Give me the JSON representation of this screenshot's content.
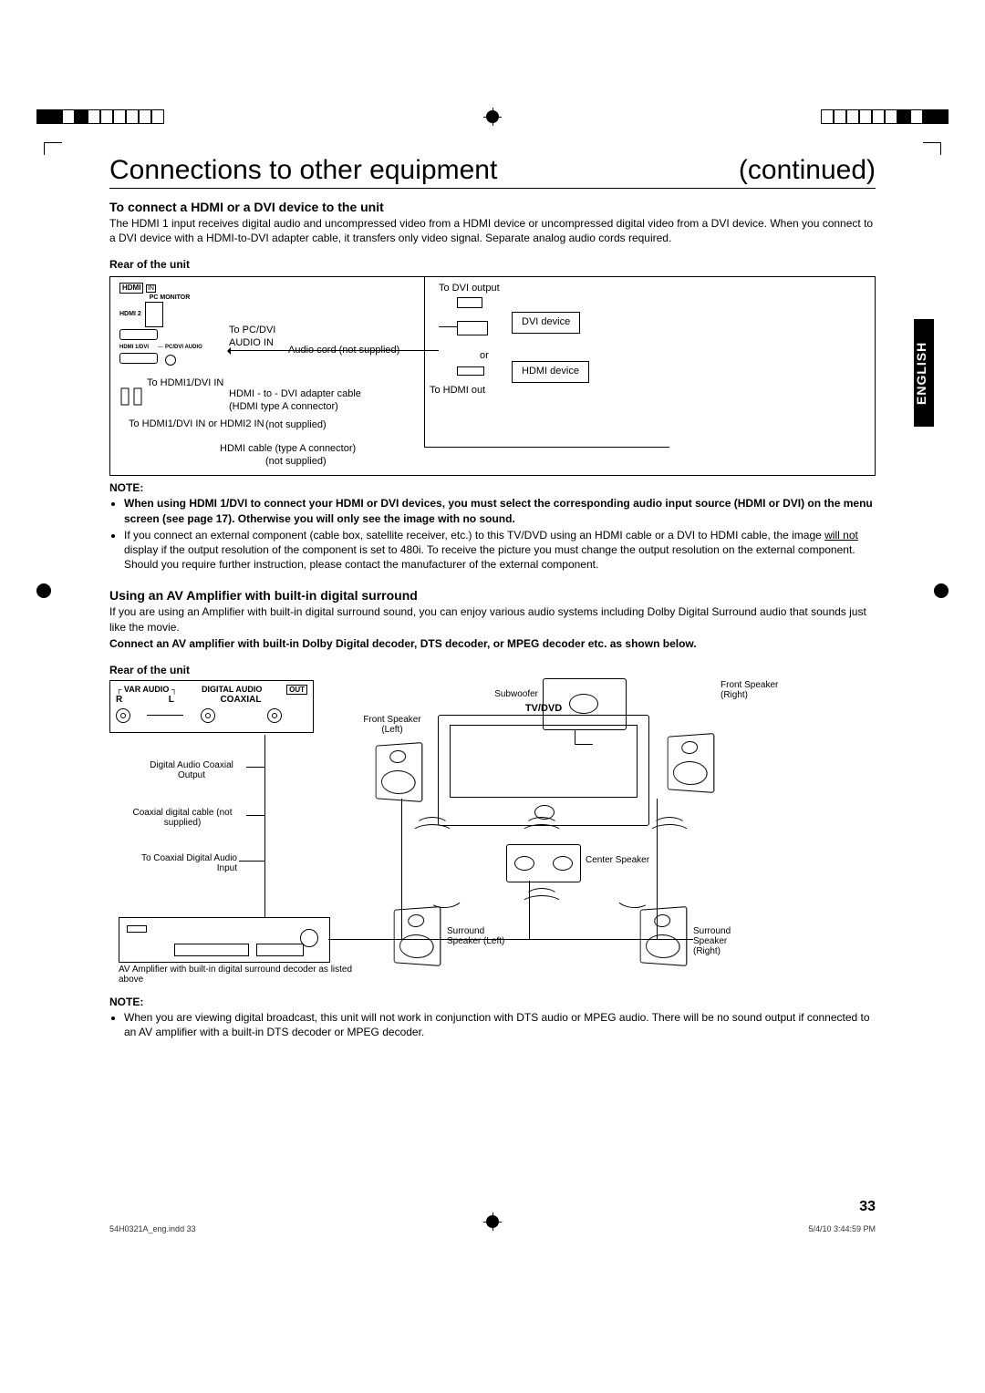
{
  "header": {
    "title": "Connections to other equipment",
    "continued": "(continued)"
  },
  "lang_tab": "ENGLISH",
  "section1": {
    "heading": "To connect a HDMI or a DVI device to the unit",
    "intro": "The HDMI 1 input receives digital audio and uncompressed video from a HDMI device or uncompressed digital video from a DVI device. When you connect to a DVI device with a HDMI-to-DVI adapter cable, it transfers only video signal. Separate analog audio cords required.",
    "rear_label": "Rear of the unit",
    "diagram": {
      "to_pc_dvi": "To PC/DVI",
      "audio_in": "AUDIO IN",
      "audio_cord": "Audio cord (not supplied)",
      "to_hdmi1_dvi_in": "To HDMI1/DVI IN",
      "adapter": "HDMI - to - DVI adapter cable",
      "hdmi_type_a": "(HDMI type A connector)",
      "not_supplied": "(not supplied)",
      "to_hdmi1_or2": "To HDMI1/DVI IN or HDMI2 IN",
      "hdmi_cable": "HDMI cable (type A connector)",
      "to_dvi_output": "To DVI output",
      "dvi_device": "DVI device",
      "hdmi_device": "HDMI device",
      "or": "or",
      "to_hdmi_out": "To HDMI out",
      "port_labels": {
        "hdmi_logo": "HDMI",
        "in": "IN",
        "pc_monitor": "PC MONITOR",
        "hdmi2": "HDMI 2",
        "hdmi1_dvi": "HDMI 1/DVI",
        "pc_dvi_audio": "PC/DVI AUDIO"
      }
    },
    "note_head": "NOTE:",
    "note1": "When using HDMI 1/DVI to connect your HDMI or DVI devices, you must select the corresponding audio input source (HDMI or DVI) on the menu screen (see page 17). Otherwise you will only see the image with no sound.",
    "note2a": "If you connect an external component (cable box, satellite receiver, etc.) to this TV/DVD using an HDMI cable or a DVI to HDMI cable, the image ",
    "note2b": "will not",
    "note2c": " display if the output resolution of the component is set to 480i. To receive the picture you must change the output resolution on the external component.",
    "note2d": "Should you require further instruction, please contact the manufacturer of the external component."
  },
  "section2": {
    "heading": "Using an AV Amplifier with built-in digital surround",
    "intro": "If you are using an Amplifier with built-in digital surround sound, you can enjoy various audio systems including Dolby Digital Surround audio that sounds just like the movie.",
    "bold_line": "Connect an AV amplifier with built-in Dolby Digital decoder, DTS decoder, or MPEG decoder etc. as shown below.",
    "rear_label": "Rear of the unit",
    "diagram": {
      "var_audio": "VAR AUDIO",
      "r": "R",
      "l": "L",
      "digital_audio": "DIGITAL AUDIO",
      "coaxial": "COAXIAL",
      "out": "OUT",
      "digital_out_label": "Digital Audio Coaxial Output",
      "coax_cable": "Coaxial digital cable (not supplied)",
      "to_coax_in": "To Coaxial Digital Audio Input",
      "amp_caption": "AV Amplifier with built-in digital surround decoder as listed above",
      "tv_dvd": "TV/DVD",
      "front_left": "Front Speaker (Left)",
      "front_right": "Front Speaker (Right)",
      "subwoofer": "Subwoofer",
      "center": "Center Speaker",
      "surround_left": "Surround Speaker (Left)",
      "surround_right": "Surround Speaker (Right)"
    },
    "note_head": "NOTE:",
    "note1": "When you are viewing digital broadcast, this unit will not work in conjunction with DTS audio or MPEG audio. There will be no sound output if connected to an AV amplifier with a built-in DTS decoder or MPEG decoder."
  },
  "page_number": "33",
  "footer": {
    "left": "54H0321A_eng.indd   33",
    "right": "5/4/10   3:44:59 PM"
  }
}
